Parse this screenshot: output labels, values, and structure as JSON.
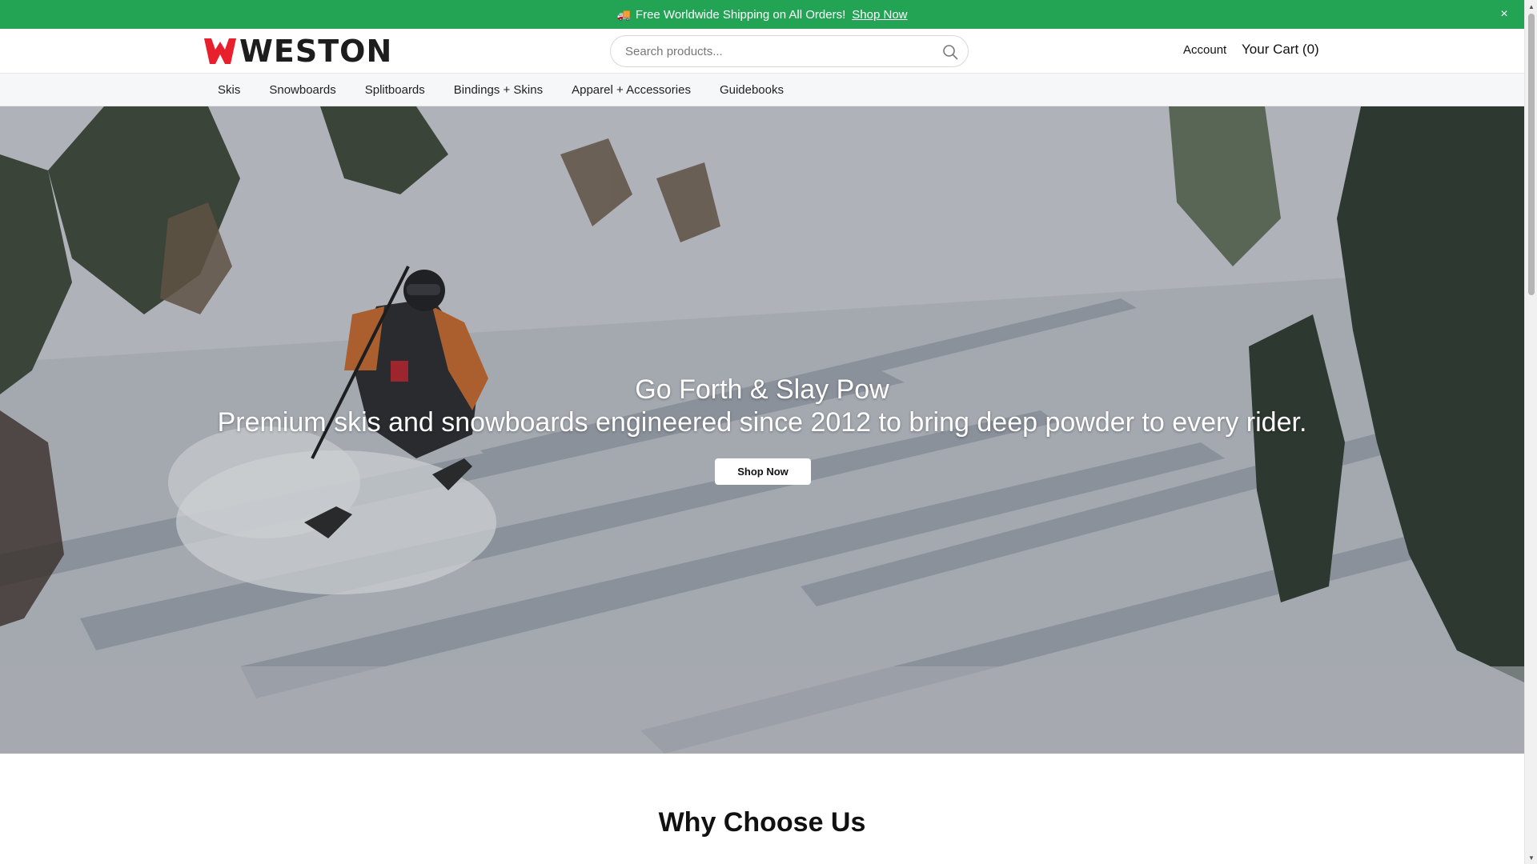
{
  "announcement": {
    "emoji": "🚚",
    "text": "Free Worldwide Shipping on All Orders!",
    "link_label": "Shop Now",
    "close_label": "×",
    "background": "#23a455"
  },
  "header": {
    "logo_text": "WESTON",
    "logo_mark_color": "#e8202e",
    "search_placeholder": "Search products...",
    "account_label": "Account",
    "cart_label": "Your Cart (0)"
  },
  "nav": {
    "items": [
      {
        "label": "Skis"
      },
      {
        "label": "Snowboards"
      },
      {
        "label": "Splitboards"
      },
      {
        "label": "Bindings + Skins"
      },
      {
        "label": "Apparel + Accessories"
      },
      {
        "label": "Guidebooks"
      }
    ]
  },
  "hero": {
    "title": "Go Forth & Slay Pow",
    "subtitle": "Premium skis and snowboards engineered since 2012 to bring deep powder to every rider.",
    "cta_label": "Shop Now"
  },
  "why": {
    "heading": "Why Choose Us"
  }
}
